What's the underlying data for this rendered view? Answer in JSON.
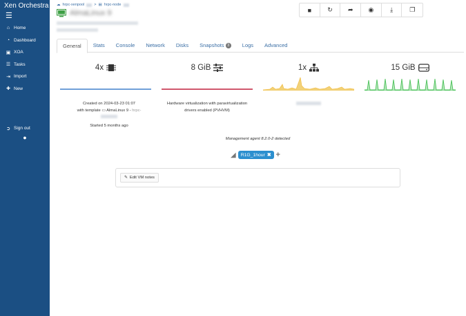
{
  "app": {
    "title": "Xen Orchestra"
  },
  "sidebar": {
    "items": [
      {
        "label": "Home",
        "icon": "home-icon"
      },
      {
        "label": "Dashboard",
        "icon": "dashboard-icon"
      },
      {
        "label": "XOA",
        "icon": "xoa-icon"
      },
      {
        "label": "Tasks",
        "icon": "tasks-icon"
      },
      {
        "label": "Import",
        "icon": "import-icon"
      },
      {
        "label": "New",
        "icon": "plus-icon"
      }
    ],
    "signout_label": "Sign out"
  },
  "breadcrumb": {
    "pool": "hrpc-xenpool",
    "host": "hrpc-node"
  },
  "vm": {
    "name": "AlmaLinux 9"
  },
  "tabs": [
    {
      "label": "General",
      "active": true
    },
    {
      "label": "Stats"
    },
    {
      "label": "Console"
    },
    {
      "label": "Network"
    },
    {
      "label": "Disks"
    },
    {
      "label": "Snapshots",
      "badge": "3"
    },
    {
      "label": "Logs"
    },
    {
      "label": "Advanced"
    }
  ],
  "stats": {
    "cpu": "4x",
    "memory": "8 GiB",
    "network": "1x",
    "disk": "15 GiB"
  },
  "colors": {
    "cpu_bar": "#6f9fd8",
    "memory_bar": "#d0566c",
    "network_bar": "#f2c14e",
    "disk_bar": "#4cc25a",
    "tag": "#2c8fcf",
    "sidebar": "#1b4f83"
  },
  "info": {
    "created": "Created on 2024-03-23 01:07",
    "template_prefix": "with template",
    "template_name": "AlmaLinux 9",
    "template_host": "hrpc-",
    "started": "Started 5 months ago",
    "virt_line1": "Hardware virtualization with paravirtualization",
    "virt_line2": "drivers enabled (PVHVM)",
    "agent": "Management agent 8.2.0-2 detected"
  },
  "tags": [
    {
      "label": "R1G_1hour"
    }
  ],
  "notes": {
    "edit_label": "Edit VM notes"
  }
}
